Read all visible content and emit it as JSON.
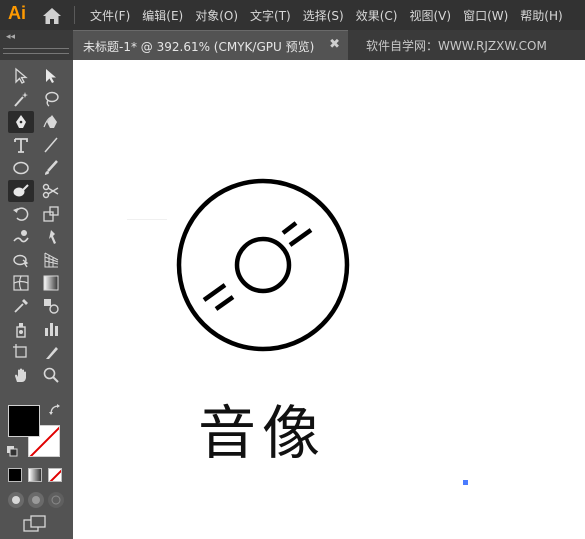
{
  "app": {
    "logo": "Ai"
  },
  "menu": {
    "items": [
      "文件(F)",
      "编辑(E)",
      "对象(O)",
      "文字(T)",
      "选择(S)",
      "效果(C)",
      "视图(V)",
      "窗口(W)",
      "帮助(H)"
    ]
  },
  "tabs": {
    "collapse_glyph": "◂◂",
    "document": "未标题-1* @ 392.61% (CMYK/GPU 预览)",
    "close": "✖",
    "watermark": "软件自学网：WWW.RJZXW.COM"
  },
  "toolbar": {
    "tools": [
      "selection-tool",
      "direct-selection-tool",
      "magic-wand-tool",
      "lasso-tool",
      "pen-tool",
      "curvature-tool",
      "type-tool",
      "line-segment-tool",
      "ellipse-tool",
      "paintbrush-tool",
      "shaper-tool",
      "scissors-tool",
      "rotate-tool",
      "scale-tool",
      "warp-tool",
      "free-transform-tool",
      "shape-builder-tool",
      "perspective-grid-tool",
      "mesh-tool",
      "gradient-tool",
      "eyedropper-tool",
      "blend-tool",
      "symbol-sprayer-tool",
      "column-graph-tool",
      "artboard-tool",
      "slice-tool",
      "hand-tool",
      "zoom-tool"
    ],
    "active_tools": [
      "pen-tool",
      "shaper-tool"
    ],
    "fill_color": "#000000",
    "stroke_color": "none"
  },
  "canvas": {
    "text": "音像",
    "selection_color": "#4a7cff"
  },
  "colors": {
    "menubar_bg": "#323232",
    "panel_bg": "#535353",
    "canvas_bg": "#ffffff",
    "logo": "#ff9a00"
  }
}
